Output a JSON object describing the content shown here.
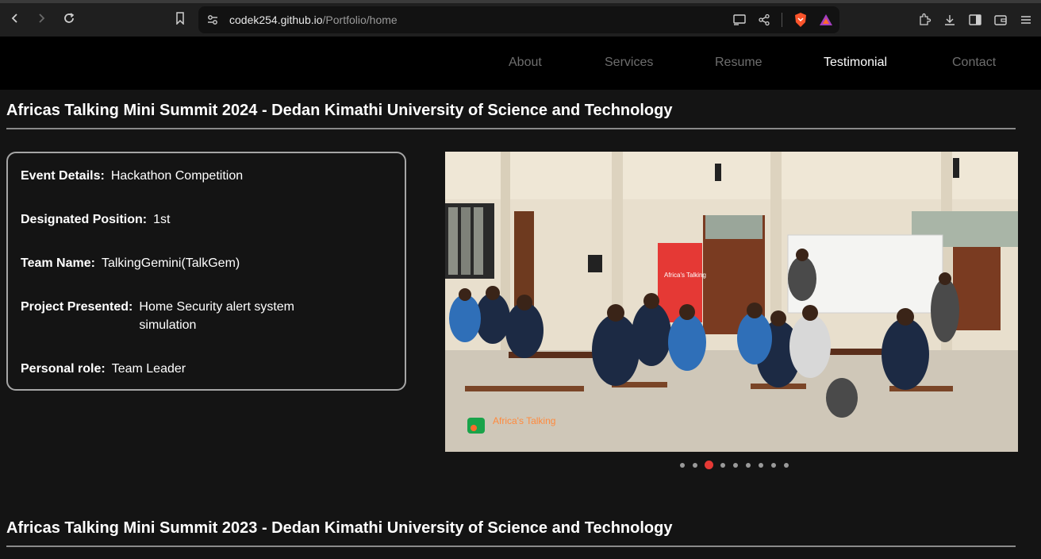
{
  "browser": {
    "url_domain": "codek254.github.io",
    "url_path": "/Portfolio/home"
  },
  "nav": {
    "items": [
      {
        "label": "About"
      },
      {
        "label": "Services"
      },
      {
        "label": "Resume"
      },
      {
        "label": "Testimonial",
        "active": true
      },
      {
        "label": "Contact"
      }
    ]
  },
  "sections": [
    {
      "title": "Africas Talking Mini Summit 2024 - Dedan Kimathi University of Science and Technology",
      "details": [
        {
          "key": "Event Details:",
          "value": "Hackathon Competition"
        },
        {
          "key": "Designated Position:",
          "value": "1st"
        },
        {
          "key": "Team Name:",
          "value": "TalkingGemini(TalkGem)"
        },
        {
          "key": "Project Presented:",
          "value": "Home Security alert system simulation"
        },
        {
          "key": "Personal role:",
          "value": "Team Leader"
        }
      ],
      "photo": {
        "banner_text": "Africa's Talking",
        "watermark_text": "Africa's Talking"
      },
      "carousel": {
        "count": 9,
        "active_index": 2
      }
    },
    {
      "title": "Africas Talking Mini Summit 2023 - Dedan Kimathi University of Science and Technology"
    }
  ],
  "colors": {
    "accent": "#e53935",
    "nav_active": "#ffffff",
    "nav_inactive": "#6e6e6e"
  }
}
